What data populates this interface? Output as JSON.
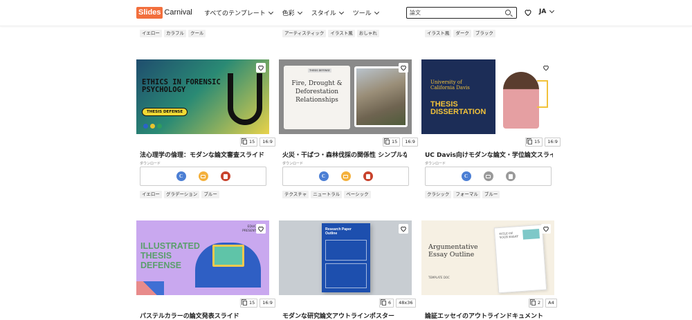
{
  "header": {
    "logo_part1": "Slides",
    "logo_part2": "Carnival",
    "nav": [
      "すべてのテンプレート",
      "色彩",
      "スタイル",
      "ツール"
    ],
    "search_value": "論文",
    "lang": "JA"
  },
  "top_tags": [
    [
      "イエロー",
      "カラフル",
      "クール"
    ],
    [
      "アーティスティック",
      "イラスト風",
      "おしゃれ"
    ],
    [
      "イラスト風",
      "ダーク",
      "ブラック"
    ]
  ],
  "cards": [
    {
      "thumb": "ETHICS IN FORENSIC PSYCHOLOGY",
      "thumb_sub": "THESIS DEFENSE",
      "pages": "15",
      "ratio": "16:9",
      "title": "法心理学の倫理：モダンな論文審査スライド",
      "download_label": "ダウンロード",
      "tags": [
        "イエロー",
        "グラデーション",
        "ブルー"
      ]
    },
    {
      "thumb": "Fire, Drought & Deforestation Relationships",
      "thumb_sub": "THESIS DEFENSE",
      "pages": "15",
      "ratio": "16:9",
      "title": "火災・干ばつ・森林伐採の関係性 シンプルな…",
      "download_label": "ダウンロード",
      "tags": [
        "テクスチャ",
        "ニュートラル",
        "ベーシック"
      ]
    },
    {
      "thumb": "University of California Davis",
      "thumb_sub": "THESIS DISSERTATION",
      "pages": "15",
      "ratio": "16:9",
      "title": "UC Davis向けモダンな論文・学位論文スライ…",
      "download_label": "ダウンロード",
      "tags": [
        "クラシック",
        "フォーマル",
        "ブルー"
      ]
    },
    {
      "thumb": "ILLUSTRATED THESIS DEFENSE",
      "thumb_sub": "EDUCATION PRESENTATION",
      "pages": "15",
      "ratio": "16:9",
      "title": "パステルカラーの論文発表スライド"
    },
    {
      "thumb": "Research Paper Outline",
      "pages": "6",
      "ratio": "48x36",
      "title": "モダンな研究論文アウトラインポスター"
    },
    {
      "thumb": "Argumentative Essay Outline",
      "thumb_sub": "TEMPLATE DOC",
      "thumb_paper": "TITLE OF YOUR ESSAY",
      "pages": "2",
      "ratio": "A4",
      "title": "論証エッセイのアウトラインドキュメント"
    }
  ],
  "colors": {
    "brand": "#f26f3d",
    "canva": "#4c7fd4",
    "slides": "#f4b13e",
    "ppt": "#c8432d"
  }
}
